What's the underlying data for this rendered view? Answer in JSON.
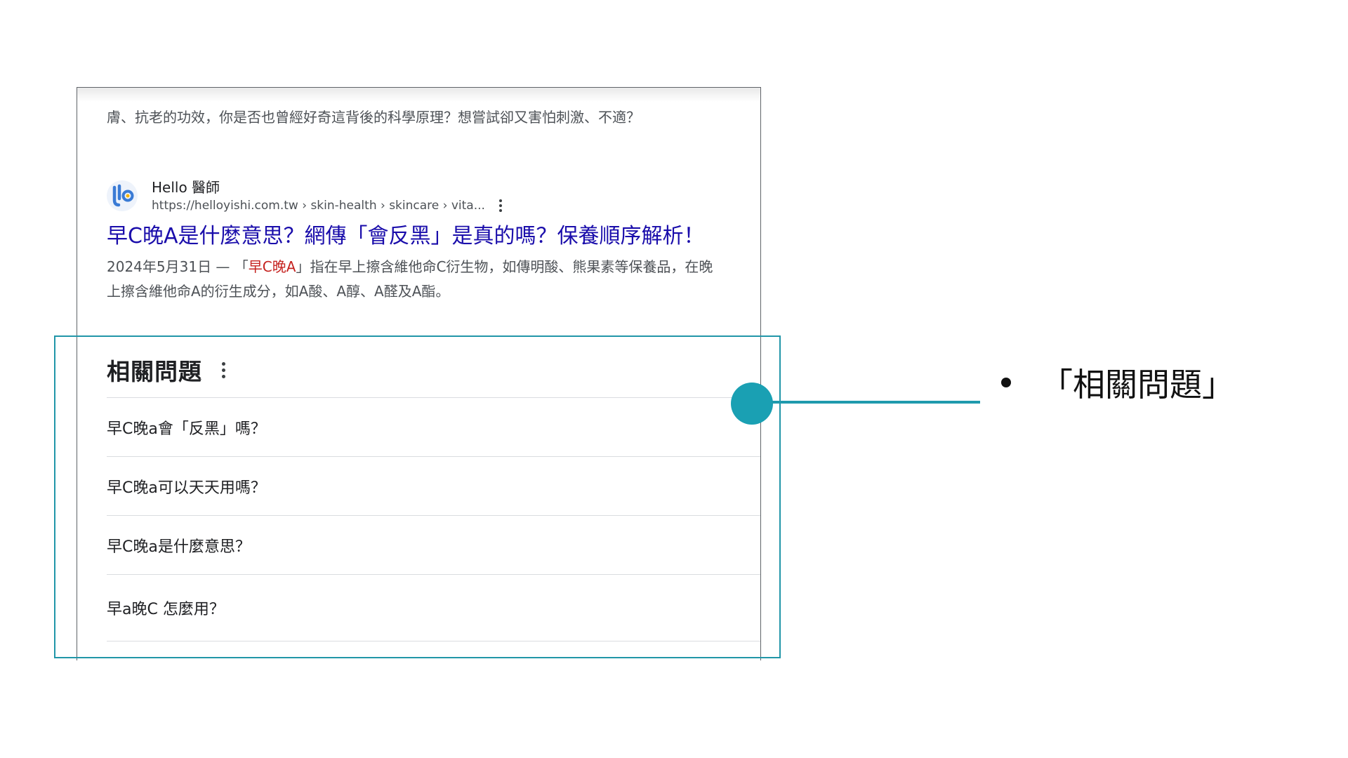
{
  "panel": {
    "top_snippet": "膚、抗老的功效，你是否也曾經好奇這背後的科學原理？想嘗試卻又害怕刺激、不適？"
  },
  "result": {
    "favicon_label": "Hello 醫師 logo",
    "site_name": "Hello 醫師",
    "url": "https://helloyishi.com.tw › skin-health › skincare › vita...",
    "title": "早C晚A是什麼意思？網傳「會反黑」是真的嗎？保養順序解析！",
    "date": "2024年5月31日 —",
    "snippet_open": " 「",
    "snippet_highlight": "早C晚A",
    "snippet_line1_rest": "」指在早上擦含維他命C衍生物，如傳明酸、熊果素等保養品，在晚",
    "snippet_line2": "上擦含維他命A的衍生成分，如A酸、A醇、A醛及A酯。"
  },
  "people_also_ask": {
    "title": "相關問題",
    "questions": [
      "早C晚a會「反黑」嗎？",
      "早C晚a可以天天用嗎？",
      "早C晚a是什麼意思？",
      "早a晚C 怎麼用？"
    ]
  },
  "annotation": {
    "label": "「相關問題」",
    "accent_color": "#1aa0b3"
  }
}
